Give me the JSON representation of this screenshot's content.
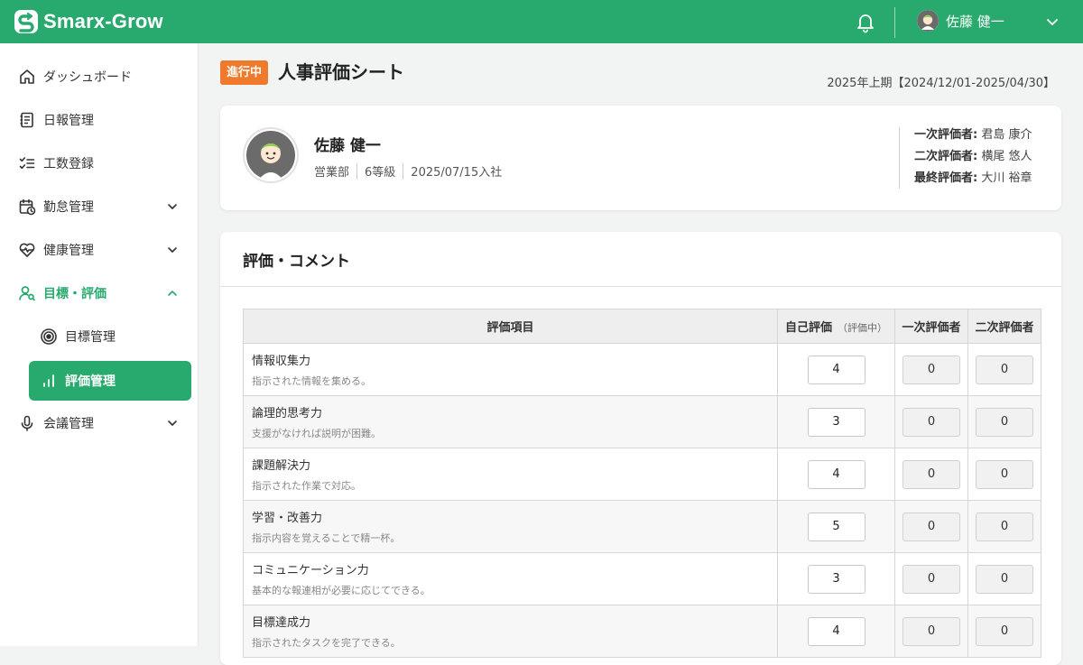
{
  "brand": {
    "name": "Smarx-Grow",
    "color": "#28a96d"
  },
  "header": {
    "user_name": "佐藤 健一"
  },
  "sidebar": {
    "items": [
      {
        "label": "ダッシュボード",
        "icon": "home-icon"
      },
      {
        "label": "日報管理",
        "icon": "notebook-icon"
      },
      {
        "label": "工数登録",
        "icon": "checklist-icon"
      },
      {
        "label": "勤怠管理",
        "icon": "calendar-clock-icon",
        "expandable": true
      },
      {
        "label": "健康管理",
        "icon": "heart-pulse-icon",
        "expandable": true
      },
      {
        "label": "目標・評価",
        "icon": "user-search-icon",
        "expanded": true
      },
      {
        "label": "会議管理",
        "icon": "microphone-icon",
        "expandable": true
      }
    ],
    "sub_items": [
      {
        "label": "目標管理",
        "icon": "target-icon"
      },
      {
        "label": "評価管理",
        "icon": "bar-chart-icon",
        "selected": true
      }
    ]
  },
  "page": {
    "status_badge": "進行中",
    "title": "人事評価シート",
    "period": "2025年上期【2024/12/01-2025/04/30】"
  },
  "profile": {
    "name": "佐藤 健一",
    "department": "営業部",
    "grade": "6等級",
    "joined": "2025/07/15入社",
    "evaluators": [
      {
        "role": "一次評価者:",
        "name": "君島 康介"
      },
      {
        "role": "二次評価者:",
        "name": "横尾 悠人"
      },
      {
        "role": "最終評価者:",
        "name": "大川 裕章"
      }
    ]
  },
  "evaluation": {
    "section_title": "評価・コメント",
    "columns": {
      "item": "評価項目",
      "self": "自己評価",
      "self_status": "（評価中）",
      "first": "一次評価者",
      "second": "二次評価者"
    },
    "rows": [
      {
        "name": "情報収集力",
        "desc": "指示された情報を集める。",
        "self": "4",
        "first": "0",
        "second": "0"
      },
      {
        "name": "論理的思考力",
        "desc": "支援がなければ説明が困難。",
        "self": "3",
        "first": "0",
        "second": "0"
      },
      {
        "name": "課題解決力",
        "desc": "指示された作業で対応。",
        "self": "4",
        "first": "0",
        "second": "0"
      },
      {
        "name": "学習・改善力",
        "desc": "指示内容を覚えることで精一杯。",
        "self": "5",
        "first": "0",
        "second": "0"
      },
      {
        "name": "コミュニケーション力",
        "desc": "基本的な報連相が必要に応じてできる。",
        "self": "3",
        "first": "0",
        "second": "0"
      },
      {
        "name": "目標達成力",
        "desc": "指示されたタスクを完了できる。",
        "self": "4",
        "first": "0",
        "second": "0"
      }
    ]
  },
  "colors": {
    "accent": "#28a96d",
    "badge": "#ef7a2c"
  }
}
